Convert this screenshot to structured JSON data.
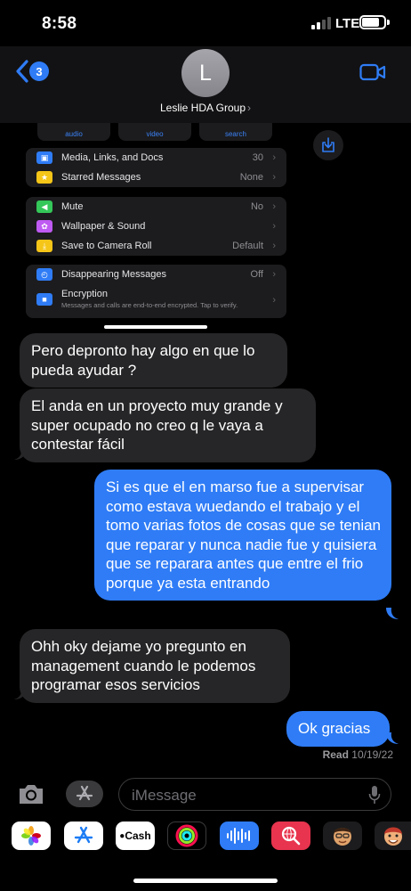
{
  "status_bar": {
    "time": "8:58",
    "network": "LTE"
  },
  "header": {
    "back_badge": "3",
    "avatar_initial": "L",
    "contact_name": "Leslie HDA Group",
    "name_chevron": "›"
  },
  "details_embed": {
    "tabs": [
      "audio",
      "video",
      "search"
    ],
    "groups": [
      [
        {
          "label": "Media, Links, and Docs",
          "value": "30",
          "icon": "photo-icon",
          "color": "#2f7cf6"
        },
        {
          "label": "Starred Messages",
          "value": "None",
          "icon": "star-icon",
          "color": "#f5c518"
        }
      ],
      [
        {
          "label": "Mute",
          "value": "No",
          "icon": "speaker-icon",
          "color": "#34c759"
        },
        {
          "label": "Wallpaper & Sound",
          "value": "",
          "icon": "flower-icon",
          "color": "#bf5af2"
        },
        {
          "label": "Save to Camera Roll",
          "value": "Default",
          "icon": "save-icon",
          "color": "#f5c518"
        }
      ],
      [
        {
          "label": "Disappearing Messages",
          "value": "Off",
          "icon": "timer-icon",
          "color": "#2f7cf6"
        },
        {
          "label": "Encryption",
          "value": "",
          "subtitle": "Messages and calls are end-to-end encrypted. Tap to verify.",
          "icon": "lock-icon",
          "color": "#2f7cf6"
        }
      ]
    ]
  },
  "messages": [
    {
      "dir": "in",
      "text": "Pero depronto hay algo en que lo pueda ayudar ?"
    },
    {
      "dir": "in",
      "text": "El anda en un proyecto muy grande y super ocupado no creo q le vaya a contestar fácil"
    },
    {
      "dir": "out",
      "text": "Si es que el en marso fue a supervisar como estava wuedando el trabajo y el tomo varias fotos de cosas que se tenian que reparar y nunca nadie fue y quisiera que se reparara antes que entre el frio porque ya esta entrando"
    },
    {
      "dir": "in",
      "text": "Ohh oky dejame yo pregunto en management cuando le podemos programar esos servicios"
    },
    {
      "dir": "out",
      "text": "Ok gracias"
    }
  ],
  "receipt": {
    "label": "Read",
    "date": "10/19/22"
  },
  "compose": {
    "placeholder": "iMessage"
  },
  "app_drawer": {
    "apple_cash_label": "Cash",
    "apps": [
      "photos-icon",
      "app-store-icon",
      "apple-cash-icon",
      "activity-rings-icon",
      "voice-memo-icon",
      "web-search-icon",
      "memoji-icon",
      "memoji-icon-2"
    ]
  },
  "colors": {
    "accent": "#2f7cf6",
    "incoming_bubble": "#262628",
    "header_bg": "#121214"
  }
}
